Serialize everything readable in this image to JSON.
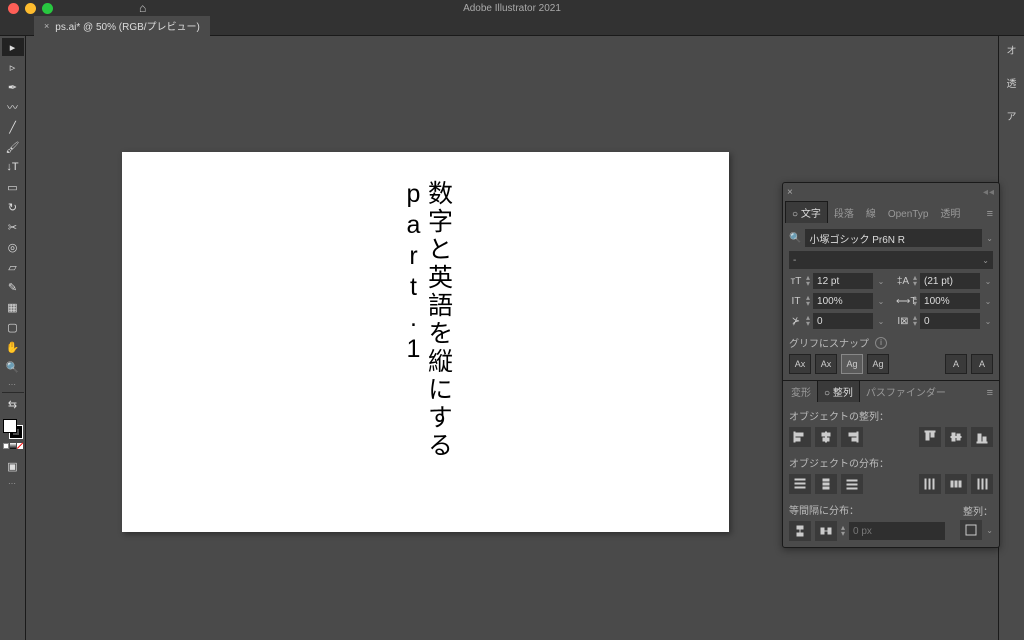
{
  "app": {
    "title": "Adobe Illustrator 2021"
  },
  "tab": {
    "close": "×",
    "label": "ps.ai* @ 50% (RGB/プレビュー)"
  },
  "canvas": {
    "text": "数字と英語を縦にする part.1"
  },
  "charPanel": {
    "tabs": {
      "moji": "○ 文字",
      "danraku": "段落",
      "sen": "線",
      "opentype": "OpenTyp",
      "toumei": "透明"
    },
    "font": "小塚ゴシック Pr6N R",
    "style": "-",
    "size": "12 pt",
    "leading": "(21 pt)",
    "vscale": "100%",
    "hscale": "100%",
    "kerning": "0",
    "tracking": "0",
    "snap": "グリフにスナップ",
    "btn": {
      "ax1": "Ax",
      "ax2": "Ax",
      "ag1": "Ag",
      "ag2": "Ag",
      "a1": "A",
      "a2": "A"
    }
  },
  "alignPanel": {
    "tabs": {
      "henkei": "変形",
      "seiretsu": "○ 整列",
      "pathfinder": "パスファインダー"
    },
    "label1": "オブジェクトの整列：",
    "label2": "オブジェクトの分布：",
    "label3": "等間隔に分布：",
    "seiretsuLabel": "整列：",
    "dim": "0 px"
  }
}
